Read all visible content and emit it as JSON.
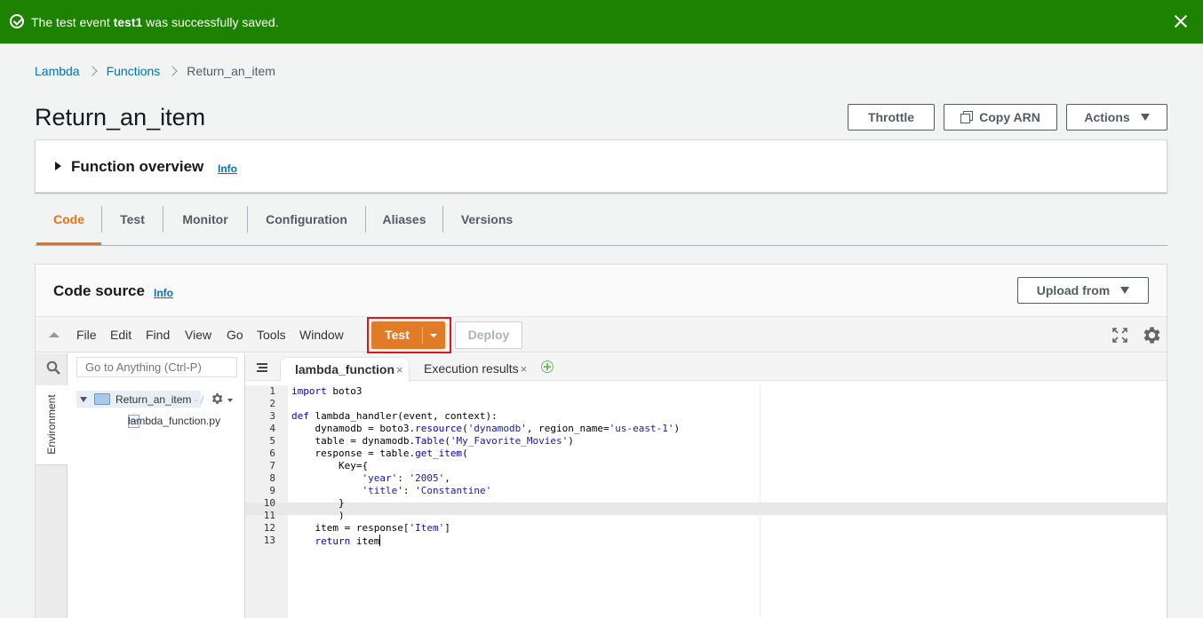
{
  "flash": {
    "prefix": "The test event ",
    "event_name": "test1",
    "suffix": " was successfully saved."
  },
  "breadcrumb": {
    "items": [
      "Lambda",
      "Functions"
    ],
    "current": "Return_an_item"
  },
  "page": {
    "title": "Return_an_item",
    "buttons": {
      "throttle": "Throttle",
      "copy_arn": "Copy ARN",
      "actions": "Actions"
    }
  },
  "overview": {
    "title": "Function overview",
    "info": "Info"
  },
  "tabs": [
    "Code",
    "Test",
    "Monitor",
    "Configuration",
    "Aliases",
    "Versions"
  ],
  "active_tab": "Code",
  "code_source": {
    "title": "Code source",
    "info": "Info",
    "upload_label": "Upload from"
  },
  "ide": {
    "menus": [
      "File",
      "Edit",
      "Find",
      "View",
      "Go",
      "Tools",
      "Window"
    ],
    "test_label": "Test",
    "deploy_label": "Deploy",
    "goto_placeholder": "Go to Anything (Ctrl-P)",
    "sidebar_tab": "Environment",
    "folder": {
      "name": "Return_an_item",
      "suffix": " - /"
    },
    "file": "lambda_function.py",
    "editor_tabs": [
      "lambda_function",
      "Execution results"
    ],
    "line_numbers": [
      "1",
      "2",
      "3",
      "4",
      "5",
      "6",
      "7",
      "8",
      "9",
      "10",
      "11",
      "12",
      "13"
    ],
    "code_lines": [
      "import boto3",
      "",
      "def lambda_handler(event, context):",
      "    dynamodb = boto3.resource('dynamodb', region_name='us-east-1')",
      "    table = dynamodb.Table('My_Favorite_Movies')",
      "    response = table.get_item(",
      "        Key={",
      "            'year': '2005',",
      "            'title': 'Constantine'",
      "        }",
      "        )",
      "    item = response['Item']",
      "    return item"
    ]
  },
  "colors": {
    "success": "#1d8102",
    "accent": "#ec7211",
    "link": "#0073bb",
    "highlight_outline": "#e0161b"
  }
}
